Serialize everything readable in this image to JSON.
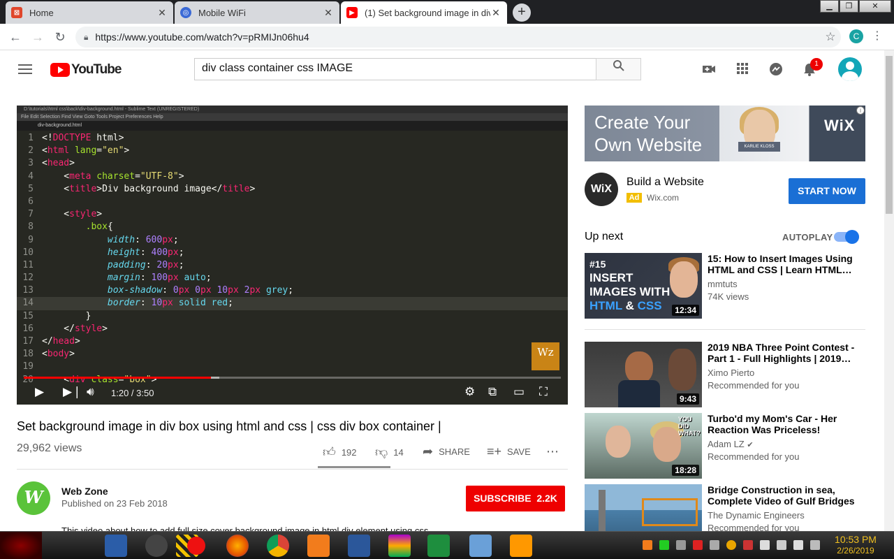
{
  "browser": {
    "tabs": [
      {
        "label": "Home",
        "active": false,
        "favicon_color": "#e0462b"
      },
      {
        "label": "Mobile WiFi",
        "active": false,
        "favicon_color": "#3b6ad6"
      },
      {
        "label": "(1) Set background image in div",
        "active": true,
        "favicon_color": "#ff0000"
      }
    ],
    "url": "https://www.youtube.com/watch?v=pRMIJn06hu4",
    "profile_initial": "C"
  },
  "youtube": {
    "logo_text": "YouTube",
    "search_value": "div class container css IMAGE",
    "notification_count": "1"
  },
  "player": {
    "editor_title": "D:\\tutorials\\html css\\back\\div-background.html - Sublime Text (UNREGISTERED)",
    "editor_menu": "File   Edit   Selection   Find   View   Goto   Tools   Project   Preferences   Help",
    "editor_tab": "div-background.html",
    "time_display": "1:20 / 3:50",
    "progress_fraction": 0.348,
    "watermark": "Wz"
  },
  "video": {
    "title": "Set background image in div box using html and css | css div box container |",
    "views": "29,962 views",
    "likes": "192",
    "dislikes": "14",
    "share_label": "SHARE",
    "save_label": "SAVE",
    "channel_name": "Web Zone",
    "published": "Published on 23 Feb 2018",
    "subscribe_label": "SUBSCRIBE",
    "subscriber_count": "2.2K",
    "description_partial": "This video about how to add full size cover background image in html div element using css"
  },
  "ad": {
    "banner_line1": "Create Your",
    "banner_line2": "Own Website",
    "banner_brand": "WiX",
    "banner_name": "KARLIE KLOSS",
    "logo_text": "WiX",
    "title": "Build a Website",
    "badge": "Ad",
    "domain": "Wix.com",
    "cta": "START NOW"
  },
  "upnext": {
    "heading": "Up next",
    "autoplay_label": "AUTOPLAY",
    "autoplay_on": true
  },
  "recommendations": [
    {
      "title": "15: How to Insert Images Using HTML and CSS | Learn HTML…",
      "channel": "mmtuts",
      "meta": "74K views",
      "duration": "12:34",
      "thumb_line1": "#15",
      "thumb_line2": "INSERT",
      "thumb_line3": "IMAGES WITH",
      "thumb_line4a": "HTML",
      "thumb_line4b": " & ",
      "thumb_line4c": "CSS"
    },
    {
      "title": "2019 NBA Three Point Contest - Part 1 - Full Highlights | 2019…",
      "channel": "Ximo Pierto",
      "meta": "Recommended for you",
      "duration": "9:43"
    },
    {
      "title": "Turbo'd my Mom's Car - Her Reaction Was Priceless!",
      "channel": "Adam LZ",
      "meta": "Recommended for you",
      "duration": "18:28",
      "thumb_text": "YOU DID WHAT?"
    },
    {
      "title": "Bridge Construction in sea, Complete Video of Gulf Bridges",
      "channel": "The Dynamic Engineers",
      "meta": "Recommended for you",
      "duration": ""
    }
  ],
  "taskbar": {
    "time": "10:53 PM",
    "date": "2/26/2019"
  }
}
